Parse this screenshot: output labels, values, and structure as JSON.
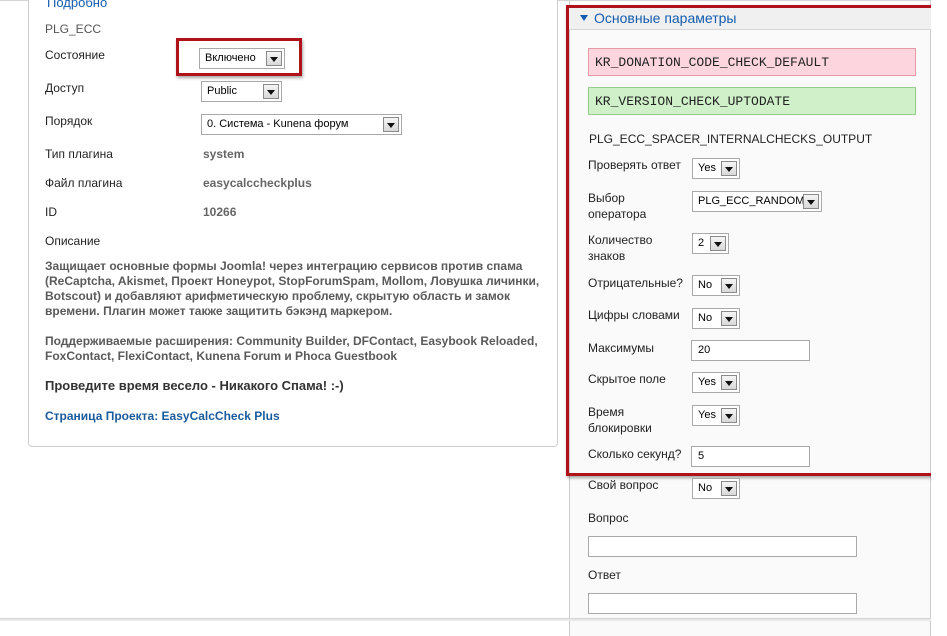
{
  "left": {
    "legend": "Подробно",
    "plugin_name": "PLG_ECC",
    "state_label": "Состояние",
    "state_value": "Включено",
    "access_label": "Доступ",
    "access_value": "Public",
    "order_label": "Порядок",
    "order_value": "0. Система - Kunena форум",
    "type_label": "Тип плагина",
    "type_value": "system",
    "file_label": "Файл плагина",
    "file_value": "easycalccheckplus",
    "id_label": "ID",
    "id_value": "10266",
    "desc_label": "Описание",
    "desc_lines": [
      "Защищает основные формы Joomla! через интеграцию сервисов против спама",
      "(ReCaptcha, Akismet, Проект Honeypot, StopForumSpam, Mollom, Ловушка личинки,",
      "Botscout) и добавляют арифметическую проблему, скрытую область и замок",
      "времени. Плагин может также защитить бэкэнд маркером."
    ],
    "ext_lines": [
      "Поддерживаемые расширения: Community Builder, DFContact, Easybook Reloaded,",
      "FoxContact, FlexiContact, Kunena Forum и Phoca Guestbook"
    ],
    "slogan": "Проведите время весело - Никакого Спама! :-)",
    "project_link": "Страница Проекта: EasyCalcCheck Plus"
  },
  "right": {
    "title": "Основные параметры",
    "msg_red": "KR_DONATION_CODE_CHECK_DEFAULT",
    "msg_green": "KR_VERSION_CHECK_UPTODATE",
    "spacer_output": "PLG_ECC_SPACER_INTERNALCHECKS_OUTPUT",
    "check_answer_label": "Проверять ответ",
    "check_answer_value": "Yes",
    "operator_label_1": "Выбор",
    "operator_label_2": "оператора",
    "operator_value": "PLG_ECC_RANDOM",
    "digits_label_1": "Количество",
    "digits_label_2": "знаков",
    "digits_value": "2",
    "negative_label": "Отрицательные?",
    "negative_value": "No",
    "words_label": "Цифры словами",
    "words_value": "No",
    "max_label": "Максимумы",
    "max_value": "20",
    "hidden_label": "Скрытое поле",
    "hidden_value": "Yes",
    "lock_label_1": "Время",
    "lock_label_2": "блокировки",
    "lock_value": "Yes",
    "seconds_label": "Сколько секунд?",
    "seconds_value": "5",
    "own_question_label": "Свой вопрос",
    "own_question_value": "No",
    "question_label": "Вопрос",
    "question_value": "",
    "answer_label": "Ответ",
    "answer_value": ""
  },
  "colors": {
    "highlight_border": "#b0121a",
    "link_blue": "#135cae",
    "error_bg": "#fcd5de",
    "success_bg": "#cff0c8"
  },
  "icons": [
    "dropdown-arrow-icon",
    "collapse-triangle-icon"
  ]
}
